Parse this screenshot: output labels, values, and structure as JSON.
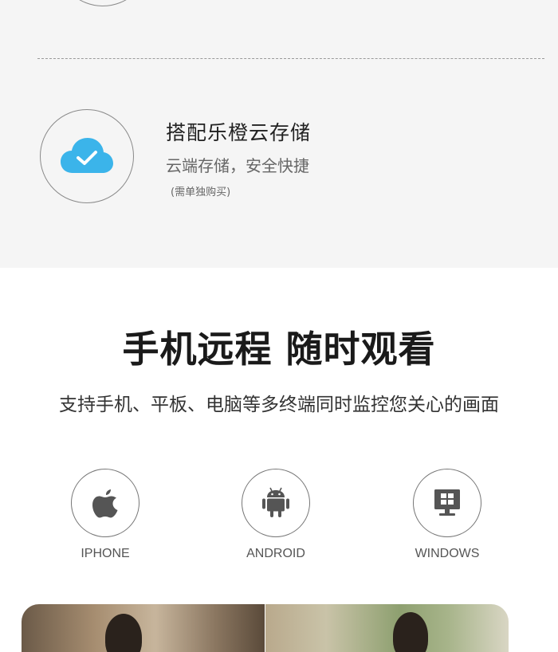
{
  "feature": {
    "title": "搭配乐橙云存储",
    "subtitle": "云端存储，安全快捷",
    "note": "(需单独购买)",
    "icon": "cloud-check-icon",
    "icon_color": "#3bb4ea"
  },
  "remote": {
    "heading": "手机远程 随时观看",
    "description": "支持手机、平板、电脑等多终端同时监控您关心的画面"
  },
  "platforms": [
    {
      "label": "IPHONE",
      "icon": "apple-icon"
    },
    {
      "label": "ANDROID",
      "icon": "android-icon"
    },
    {
      "label": "WINDOWS",
      "icon": "windows-pc-icon"
    }
  ],
  "colors": {
    "top_background": "#f5f5f5",
    "icon_dark": "#555555"
  }
}
